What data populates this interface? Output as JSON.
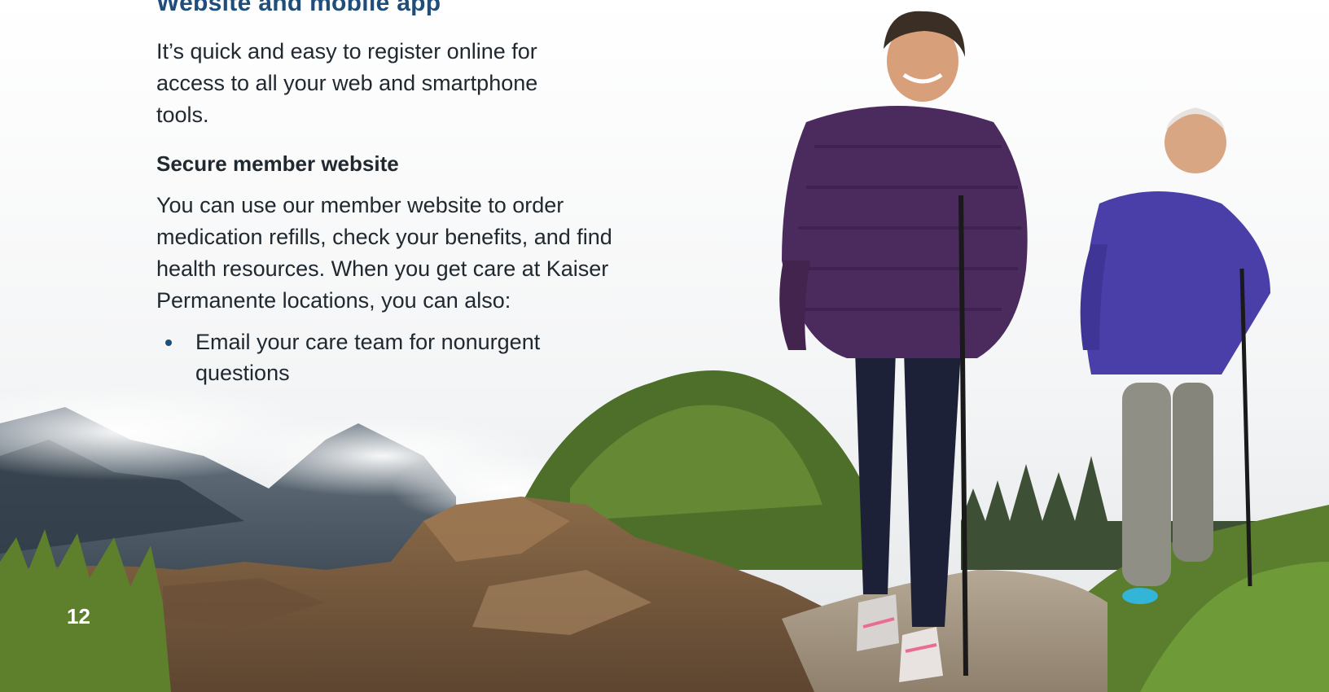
{
  "page": {
    "title": "Website and mobile app",
    "intro": "It’s quick and easy to register online for access to all your web and smartphone tools.",
    "section": {
      "heading": "Secure member website",
      "body": "You can use our member website to order medication refills, check your benefits, and find health resources. When you get care at Kaiser Permanente locations, you can also:",
      "bullets": [
        "Email your care team for nonurgent questions"
      ]
    },
    "page_number": "12"
  },
  "photo": {
    "subject": "Older couple hiking on a mountain trail with trekking poles",
    "colors": {
      "heading": "#1f4e7a",
      "jacket_woman": "#4b2a5e",
      "jacket_man": "#4a3fa8",
      "grass": "#5b7d2e",
      "rock": "#7a5a3c",
      "mist": "#e6e9ec"
    }
  }
}
